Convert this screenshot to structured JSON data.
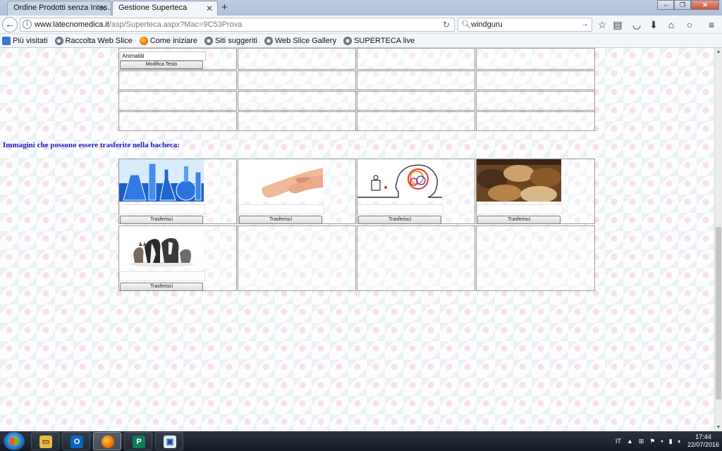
{
  "browser": {
    "tabs": [
      {
        "title": "Ordine Prodotti senza Intes...",
        "active": false
      },
      {
        "title": "Gestione Superteca",
        "active": true
      }
    ],
    "url": "www.latecnomedica.it/asp/Superteca.aspx?Mac=9C53Prova",
    "url_host": "www.latecnomedica.it",
    "url_path": "/asp/Superteca.aspx?Mac=9C53Prova",
    "search_value": "windguru",
    "bookmarks": [
      "Più visitati",
      "Raccolta Web Slice",
      "Come iniziare",
      "Siti suggeriti",
      "Web Slice Gallery",
      "SUPERTECA live"
    ]
  },
  "top_grid": {
    "text_value": "Animaliiii",
    "edit_button": "Modifica Testo"
  },
  "section_heading": "Immagini che possono essere trasferite nella bacheca:",
  "images": [
    {
      "subject": "laboratory-glassware",
      "button": "Trasferisci"
    },
    {
      "subject": "legs",
      "button": "Trasferisci"
    },
    {
      "subject": "brain-drawing",
      "button": "Trasferisci"
    },
    {
      "subject": "spice-sacks",
      "button": "Trasferisci"
    },
    {
      "subject": "cats-and-dogs",
      "button": "Trasferisci"
    }
  ],
  "taskbar": {
    "lang": "IT",
    "time": "17:44",
    "date": "22/07/2016"
  }
}
